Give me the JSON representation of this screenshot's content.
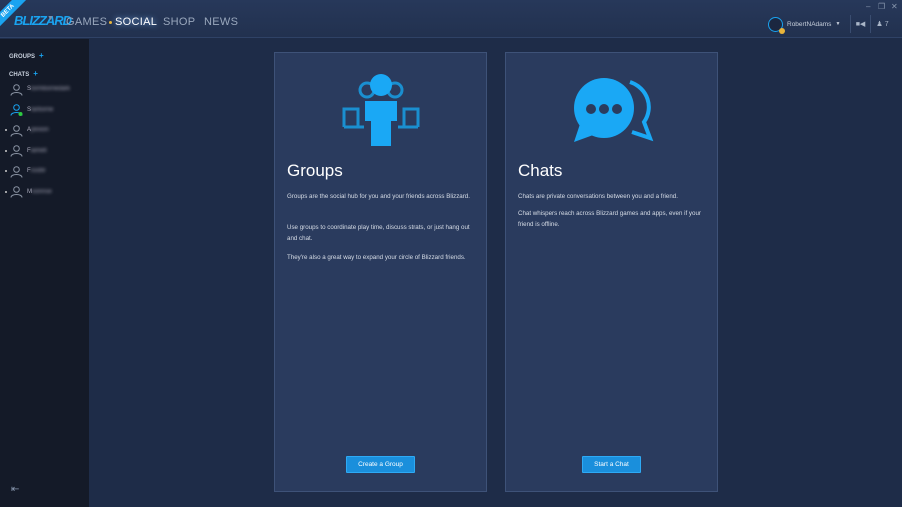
{
  "header": {
    "beta_badge": "BETA",
    "logo": "BLIZZARD",
    "nav": [
      "GAMES",
      "SOCIAL",
      "SHOP",
      "NEWS"
    ],
    "active_nav": "SOCIAL",
    "username": "RobertNAdams",
    "friends_count": "7"
  },
  "sidebar": {
    "groups_label": "GROUPS",
    "chats_label": "CHATS",
    "plus": "+",
    "friends": [
      {
        "initial": "S",
        "rest": "tormbornedark",
        "status": "offline",
        "unread": false
      },
      {
        "initial": "S",
        "rest": "tarborne",
        "status": "online",
        "unread": false
      },
      {
        "initial": "A",
        "rest": "pexion",
        "status": "offline",
        "unread": true
      },
      {
        "initial": "F",
        "rest": "lamelt",
        "status": "offline",
        "unread": true
      },
      {
        "initial": "F",
        "rest": "rostfir",
        "status": "offline",
        "unread": true
      },
      {
        "initial": "M",
        "rest": "oonrise",
        "status": "offline",
        "unread": true
      }
    ],
    "collapse_icon": "⇤"
  },
  "groups": {
    "title": "Groups",
    "p1": "Groups are the social hub for you and your friends across Blizzard.",
    "p2": "Use groups to coordinate play time, discuss strats, or just hang out and chat.",
    "p3": "They're also a great way to expand your circle of Blizzard friends.",
    "button": "Create a Group"
  },
  "chats": {
    "title": "Chats",
    "p1": "Chats are private conversations between you and a friend.",
    "p2": "Chat whispers reach across Blizzard games and apps, even if your friend is offline.",
    "button": "Start a Chat"
  },
  "colors": {
    "accent": "#1aa3f0",
    "online": "#2ecc40",
    "away": "#e8b43a"
  }
}
